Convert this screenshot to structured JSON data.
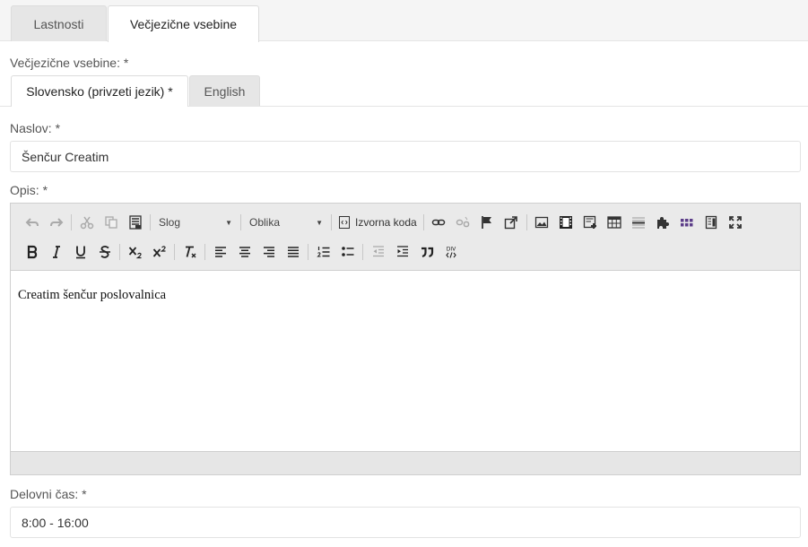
{
  "tabs": {
    "properties": "Lastnosti",
    "multilingual": "Večjezične vsebine"
  },
  "form": {
    "multilingual_label": "Večjezične vsebine: *",
    "languages": {
      "sl": "Slovensko (privzeti jezik) *",
      "en": "English"
    },
    "title_label": "Naslov: *",
    "title_value": "Šenčur Creatim",
    "description_label": "Opis: *",
    "hours_label": "Delovni čas: *",
    "hours_value": "8:00 - 16:00"
  },
  "editor": {
    "style_combo": "Slog",
    "format_combo": "Oblika",
    "source_button": "Izvorna koda",
    "div_label": "DIV",
    "content_text": "Creatim šenčur poslovalnica"
  },
  "colors": {
    "accent_purple": "#5b3c88",
    "toolbar_bg": "#eaeaea"
  }
}
